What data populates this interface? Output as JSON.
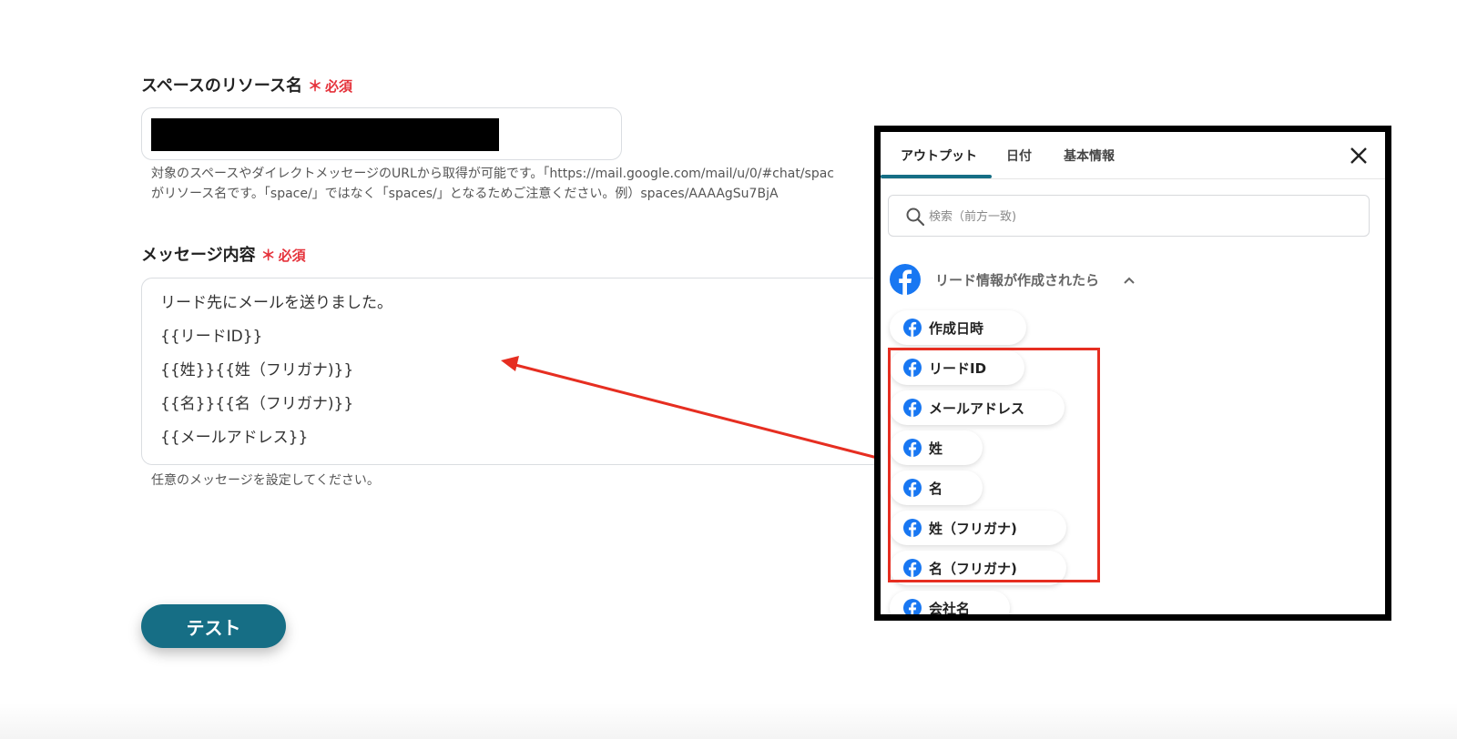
{
  "form": {
    "resource_field": {
      "label": "スペースのリソース名",
      "required_mark": "＊",
      "required_text": "必須",
      "help_line1": "対象のスペースやダイレクトメッセージのURLから取得が可能です。「https://mail.google.com/mail/u/0/#chat/spac",
      "help_line2": "がリソース名です。「space/」ではなく「spaces/」となるためご注意ください。例）spaces/AAAAgSu7BjA"
    },
    "message_field": {
      "label": "メッセージ内容",
      "required_mark": "＊",
      "required_text": "必須",
      "lines": [
        "リード先にメールを送りました。",
        "{{リードID}}",
        "{{姓}}{{姓（フリガナ)}}",
        "{{名}}{{名（フリガナ)}}",
        "{{メールアドレス}}"
      ],
      "help": "任意のメッセージを設定してください。"
    },
    "test_button_label": "テスト"
  },
  "panel": {
    "tabs": [
      {
        "label": "アウトプット",
        "active": true
      },
      {
        "label": "日付",
        "active": false
      },
      {
        "label": "基本情報",
        "active": false
      }
    ],
    "search_placeholder": "検索（前方一致)",
    "group": {
      "title": "リード情報が作成されたら",
      "icon": "facebook-icon",
      "expanded": true
    },
    "chips": [
      "作成日時",
      "リードID",
      "メールアドレス",
      "姓",
      "名",
      "姓（フリガナ)",
      "名（フリガナ)",
      "会社名"
    ]
  },
  "colors": {
    "accent": "#166e85",
    "required": "#e5323b",
    "annotation": "#e62e21",
    "facebook": "#1877f2"
  }
}
